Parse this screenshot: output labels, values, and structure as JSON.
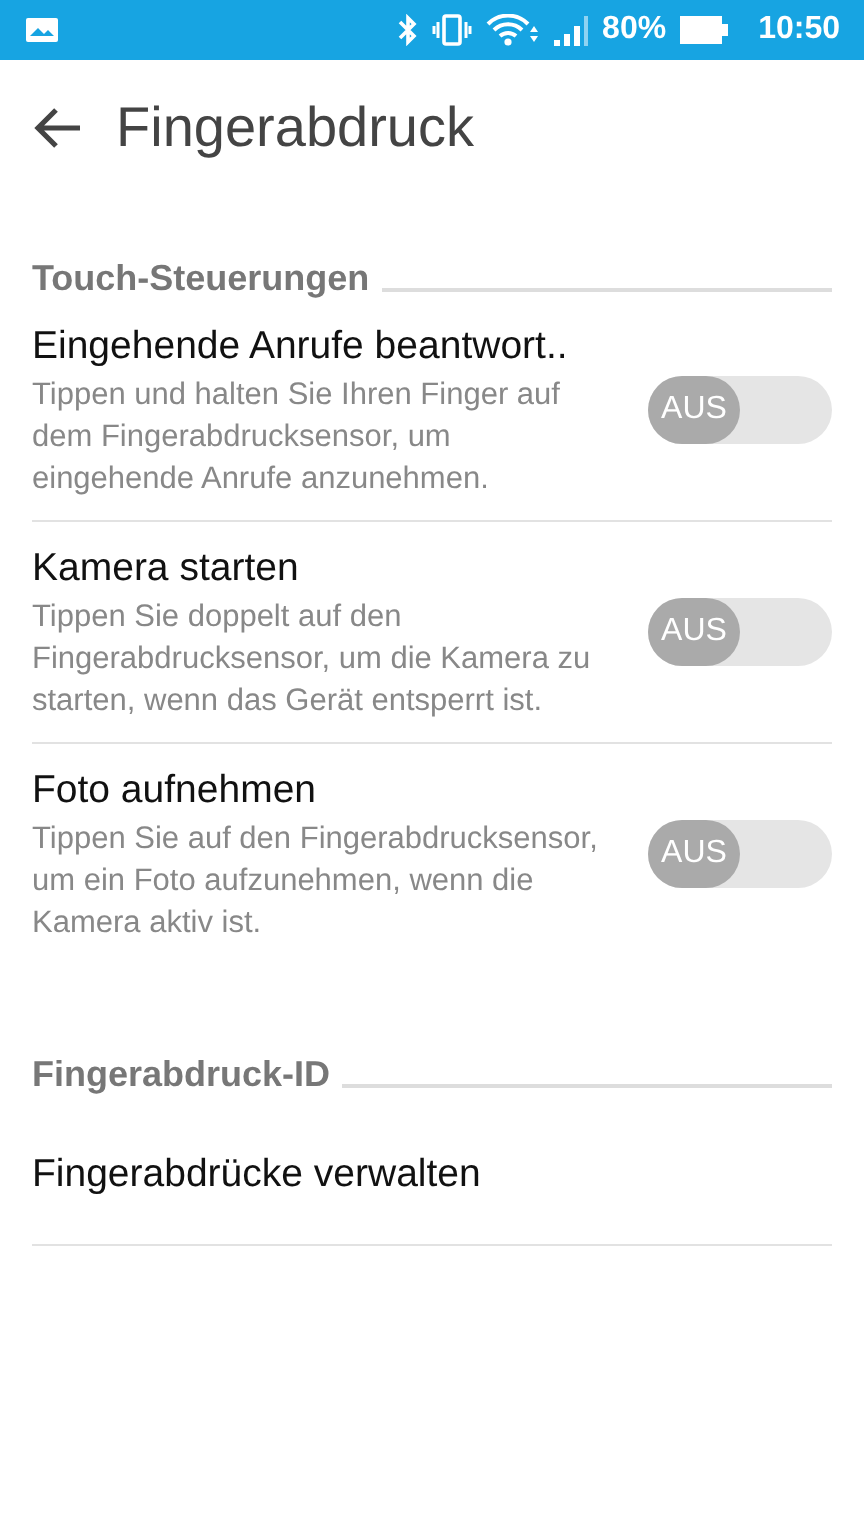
{
  "status_bar": {
    "battery_text": "80%",
    "time": "10:50"
  },
  "header": {
    "title": "Fingerabdruck"
  },
  "sections": [
    {
      "title": "Touch-Steuerungen",
      "items": [
        {
          "kind": "toggle",
          "title": "Eingehende Anrufe beantwort..",
          "summary": "Tippen und halten Sie Ihren Finger auf dem Fingerabdrucksensor, um eingehende Anrufe anzunehmen.",
          "toggle_label": "AUS",
          "on": false
        },
        {
          "kind": "toggle",
          "title": "Kamera starten",
          "summary": "Tippen Sie doppelt auf den Fingerabdrucksensor, um die Kamera zu starten, wenn das Gerät entsperrt ist.",
          "toggle_label": "AUS",
          "on": false
        },
        {
          "kind": "toggle",
          "title": "Foto aufnehmen",
          "summary": "Tippen Sie auf den Fingerabdrucksensor, um ein Foto aufzunehmen, wenn die Kamera aktiv ist.",
          "toggle_label": "AUS",
          "on": false
        }
      ]
    },
    {
      "title": "Fingerabdruck-ID",
      "items": [
        {
          "kind": "link",
          "title": "Fingerabdrücke verwalten"
        }
      ]
    }
  ]
}
